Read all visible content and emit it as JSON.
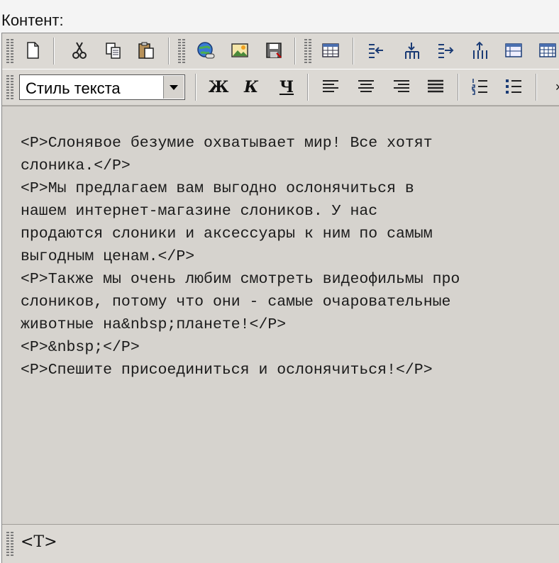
{
  "label": "Контент:",
  "toolbar1": {
    "buttons": [
      "new-document",
      "cut",
      "copy",
      "paste",
      "insert-link",
      "insert-image",
      "save",
      "insert-table",
      "insert-column-left",
      "insert-row",
      "insert-column-right",
      "insert-row-above",
      "table-properties",
      "table-grid"
    ]
  },
  "toolbar2": {
    "style_select": "Стиль текста",
    "bold": "Ж",
    "italic": "К",
    "underline": "Ч",
    "more": "×"
  },
  "code_lines": [
    "<P>Слонявое безумие охватывает мир! Все хотят",
    "слоника.</P>",
    "<P>Мы предлагаем вам выгодно ослонячиться в",
    "нашем интернет-магазине слоников. У нас",
    "продаются слоники и аксессуары к ним по самым",
    "выгодным ценам.</P>",
    "<P>Также мы очень любим смотреть видеофильмы про",
    "слоников, потому что они - самые очаровательные",
    "животные на&nbsp;планете!</P>",
    "<P>&nbsp;</P>",
    "<P>Спешите присоединиться и ослонячиться!</P>"
  ],
  "status": {
    "mode_tag": "<T>"
  }
}
